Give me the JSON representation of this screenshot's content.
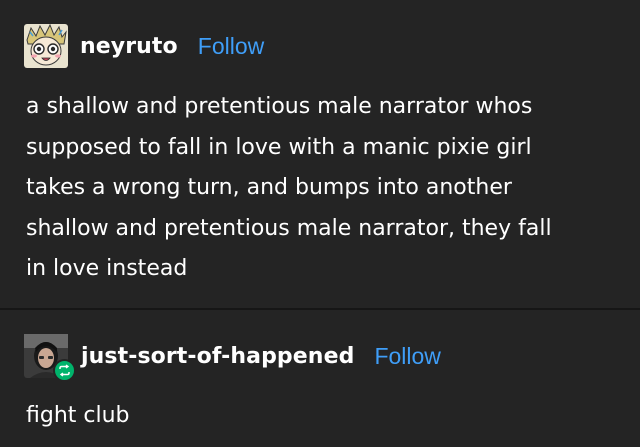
{
  "colors": {
    "background": "#242424",
    "text": "#ffffff",
    "follow_link": "#3f9ef8",
    "reblog_badge": "#00b36b",
    "divider": "#161616"
  },
  "posts": [
    {
      "username": "neyruto",
      "follow_label": "Follow",
      "avatar_icon": "anime-face-avatar",
      "body": "a shallow and pretentious male narrator whos\nsupposed to fall in love with a manic pixie girl\ntakes a wrong turn, and bumps into another\nshallow and pretentious male narrator, they fall\nin love instead"
    },
    {
      "username": "just-sort-of-happened",
      "follow_label": "Follow",
      "avatar_icon": "photo-avatar",
      "badge_icon": "reblog-icon",
      "body": "fight club"
    }
  ]
}
